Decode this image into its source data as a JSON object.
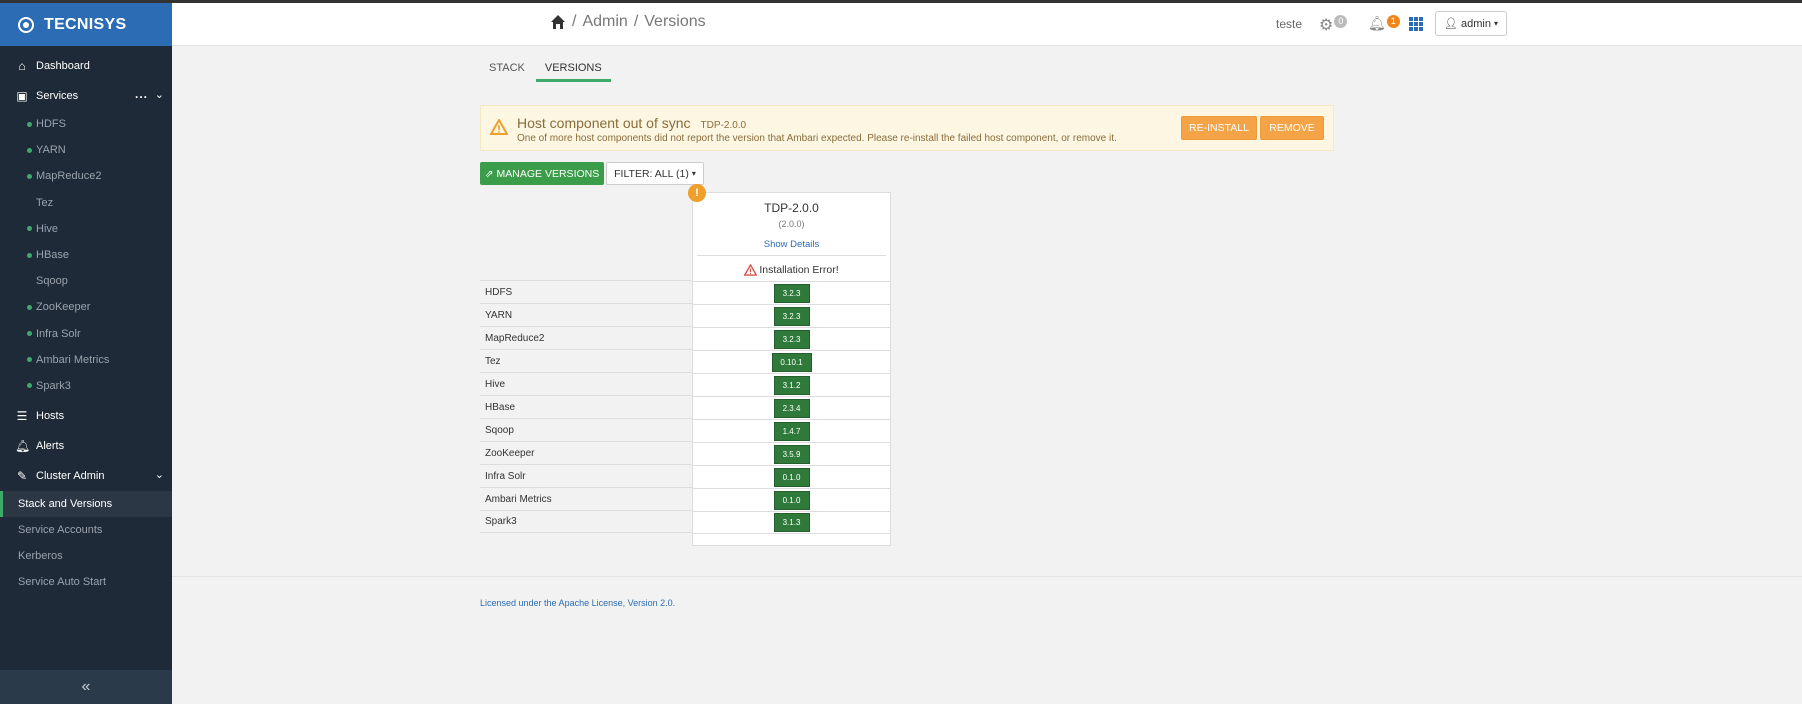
{
  "brand": {
    "name": "TECNISYS"
  },
  "sidebar": {
    "dashboard": "Dashboard",
    "services": "Services",
    "services_dots": "...",
    "service_items": [
      {
        "label": "HDFS",
        "status": true
      },
      {
        "label": "YARN",
        "status": true
      },
      {
        "label": "MapReduce2",
        "status": true
      },
      {
        "label": "Tez",
        "status": false
      },
      {
        "label": "Hive",
        "status": true
      },
      {
        "label": "HBase",
        "status": true
      },
      {
        "label": "Sqoop",
        "status": false
      },
      {
        "label": "ZooKeeper",
        "status": true
      },
      {
        "label": "Infra Solr",
        "status": true
      },
      {
        "label": "Ambari Metrics",
        "status": true
      },
      {
        "label": "Spark3",
        "status": true
      }
    ],
    "hosts": "Hosts",
    "alerts": "Alerts",
    "cluster_admin": "Cluster Admin",
    "cluster_admin_items": [
      "Stack and Versions",
      "Service Accounts",
      "Kerberos",
      "Service Auto Start"
    ],
    "collapse_icon": "«"
  },
  "header": {
    "crumb_admin": "Admin",
    "crumb_sep": "/",
    "crumb_page": "Versions",
    "user": "teste",
    "ops_count": "0",
    "alerts_count": "1",
    "admin_label": "admin"
  },
  "tabs": {
    "stack": "STACK",
    "versions": "VERSIONS"
  },
  "alert": {
    "title": "Host component out of sync",
    "version": "TDP-2.0.0",
    "message": "One of more host components did not report the version that Ambari expected. Please re-install the failed host component, or remove it.",
    "reinstall": "RE-INSTALL",
    "remove": "REMOVE"
  },
  "toolbar": {
    "manage": "MANAGE VERSIONS",
    "filter": "FILTER: ALL (1)"
  },
  "version_card": {
    "name": "TDP-2.0.0",
    "number": "(2.0.0)",
    "show_details": "Show Details",
    "status": "Installation Error!",
    "error_mark": "!"
  },
  "services": [
    {
      "name": "HDFS",
      "version": "3.2.3"
    },
    {
      "name": "YARN",
      "version": "3.2.3"
    },
    {
      "name": "MapReduce2",
      "version": "3.2.3"
    },
    {
      "name": "Tez",
      "version": "0.10.1"
    },
    {
      "name": "Hive",
      "version": "3.1.2"
    },
    {
      "name": "HBase",
      "version": "2.3.4"
    },
    {
      "name": "Sqoop",
      "version": "1.4.7"
    },
    {
      "name": "ZooKeeper",
      "version": "3.5.9"
    },
    {
      "name": "Infra Solr",
      "version": "0.1.0"
    },
    {
      "name": "Ambari Metrics",
      "version": "0.1.0"
    },
    {
      "name": "Spark3",
      "version": "3.1.3"
    }
  ],
  "footer": {
    "license": "Licensed under the Apache License, Version 2.0."
  },
  "colors": {
    "brand": "#2b6cb5",
    "success": "#3fa86b",
    "warning": "#f4a347",
    "sidebar": "#1e2a37"
  }
}
